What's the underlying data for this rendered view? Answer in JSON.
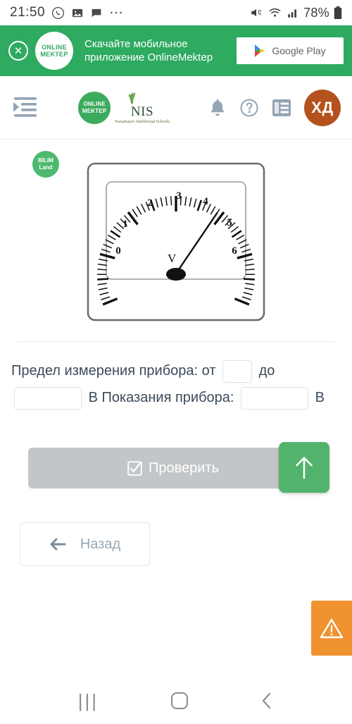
{
  "status_bar": {
    "time": "21:50",
    "icons": [
      "whatsapp-icon",
      "image-icon",
      "message-icon",
      "overflow-dots-icon"
    ],
    "mute_icon": "mute-icon",
    "wifi_icon": "wifi-icon",
    "signal_icon": "signal-icon",
    "battery_percent": "78%",
    "battery_icon": "battery-icon"
  },
  "banner": {
    "close_label": "✕",
    "logo_line1": "ONLINE",
    "logo_line2": "MEKTEP",
    "text": "Скачайте мобильное приложение OnlineMektep",
    "store_label": "Google Play",
    "bg_color": "#2eaa61"
  },
  "navbar": {
    "menu_icon": "menu-indent-icon",
    "online_mektep_line1": "ONLINE",
    "online_mektep_line2": "MEKTEP",
    "nis_title": "NIS",
    "nis_subtitle": "Nazarbayev Intellectual Schools",
    "bell_icon": "bell-icon",
    "help_icon": "question-circle-icon",
    "list_icon": "list-icon",
    "avatar_initials": "ХД",
    "avatar_color": "#b4521d"
  },
  "content": {
    "bilim_line1": "BILIM",
    "bilim_line2": "Land",
    "instrument": {
      "type": "analog-voltmeter",
      "unit_symbol": "V",
      "scale_labels": [
        "0",
        "1",
        "2",
        "3",
        "4",
        "5",
        "6"
      ],
      "scale_min": 0,
      "scale_max": 6,
      "needle_value": 3.9
    },
    "question1_prefix": "Предел измерения прибора: от",
    "question1_middle": "до",
    "question1_unit": "В",
    "question1_from_value": "",
    "question1_to_value": "",
    "question2_label": "Показания прибора:",
    "question2_value": "",
    "question2_unit": "В"
  },
  "actions": {
    "check_label": "Проверить",
    "check_icon": "checkbox-icon",
    "check_color": "#c3c6c8",
    "scroll_top_icon": "arrow-up-icon",
    "scroll_top_color": "#51b36c",
    "back_label": "Назад",
    "back_icon": "arrow-left-icon",
    "warning_icon": "warning-triangle-icon",
    "warning_color": "#f0922f"
  },
  "android_nav": {
    "recents_icon": "recents-icon",
    "home_icon": "home-icon",
    "back_icon": "back-chevron-icon"
  }
}
